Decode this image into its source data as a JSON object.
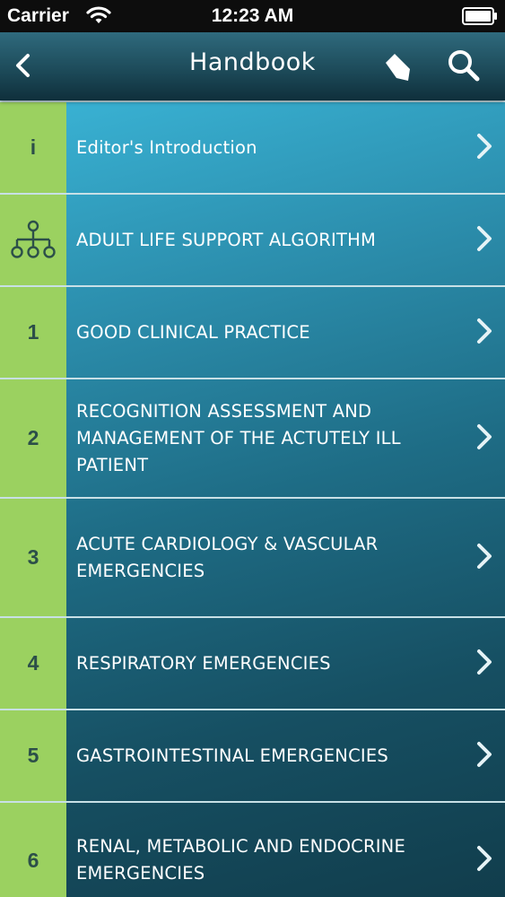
{
  "status_bar": {
    "carrier": "Carrier",
    "time": "12:23 AM"
  },
  "nav_bar": {
    "title": "Handbook",
    "back_icon": "chevron-left-icon",
    "bookmark_icon": "bookmark-icon",
    "search_icon": "search-icon"
  },
  "colors": {
    "number_tile": "#9bd160",
    "number_text": "#2c4f49",
    "row_separator": "#c8e0e6",
    "list_bg_top": "#3ab4d6",
    "list_bg_bottom": "#113d4c"
  },
  "sections": [
    {
      "marker": "i",
      "label": "Editor's Introduction"
    },
    {
      "marker": "",
      "marker_icon": "algorithm-tree-icon",
      "label": "ADULT LIFE SUPPORT ALGORITHM"
    },
    {
      "marker": "1",
      "label": "GOOD CLINICAL PRACTICE"
    },
    {
      "marker": "2",
      "label": "RECOGNITION ASSESSMENT AND MANAGEMENT OF THE ACTUTELY ILL PATIENT"
    },
    {
      "marker": "3",
      "label": "ACUTE CARDIOLOGY & VASCULAR EMERGENCIES"
    },
    {
      "marker": "4",
      "label": "RESPIRATORY EMERGENCIES"
    },
    {
      "marker": "5",
      "label": "GASTROINTESTINAL EMERGENCIES"
    },
    {
      "marker": "6",
      "label": "RENAL, METABOLIC AND ENDOCRINE EMERGENCIES"
    }
  ]
}
